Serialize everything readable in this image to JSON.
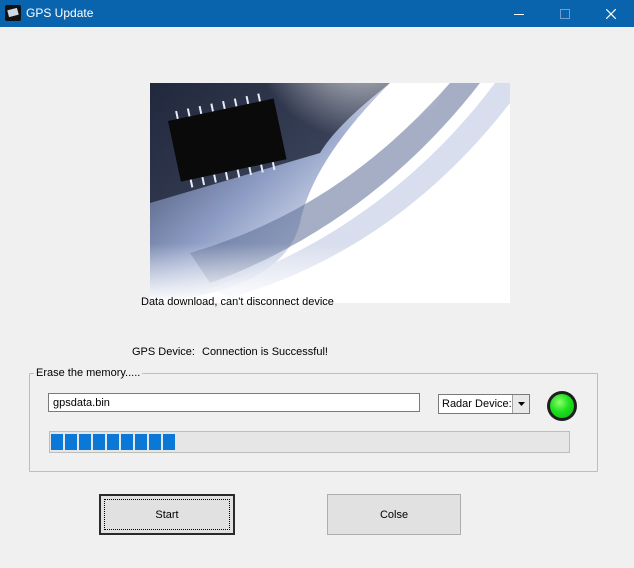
{
  "window": {
    "title": "GPS Update",
    "controls": {
      "minimize_icon": "minimize-icon",
      "maximize_icon": "maximize-icon",
      "close_icon": "close-icon"
    }
  },
  "banner": {
    "image": "microchip-banner"
  },
  "status_message": "Data download, can't disconnect device",
  "gps": {
    "label": "GPS Device:",
    "value": "Connection is Successful!"
  },
  "erase_group": {
    "legend": "Erase the memory.....",
    "file_input_value": "gpsdata.bin",
    "device_select": {
      "selected": "Radar Device:"
    },
    "indicator": {
      "status": "connected",
      "color": "#1ee01e"
    },
    "progress": {
      "filled_segments": 9,
      "segment_color": "#0a78d7"
    }
  },
  "buttons": {
    "start_label": "Start",
    "close_label": "Colse"
  },
  "colors": {
    "titlebar": "#0a64ad",
    "accent": "#0a78d7"
  }
}
